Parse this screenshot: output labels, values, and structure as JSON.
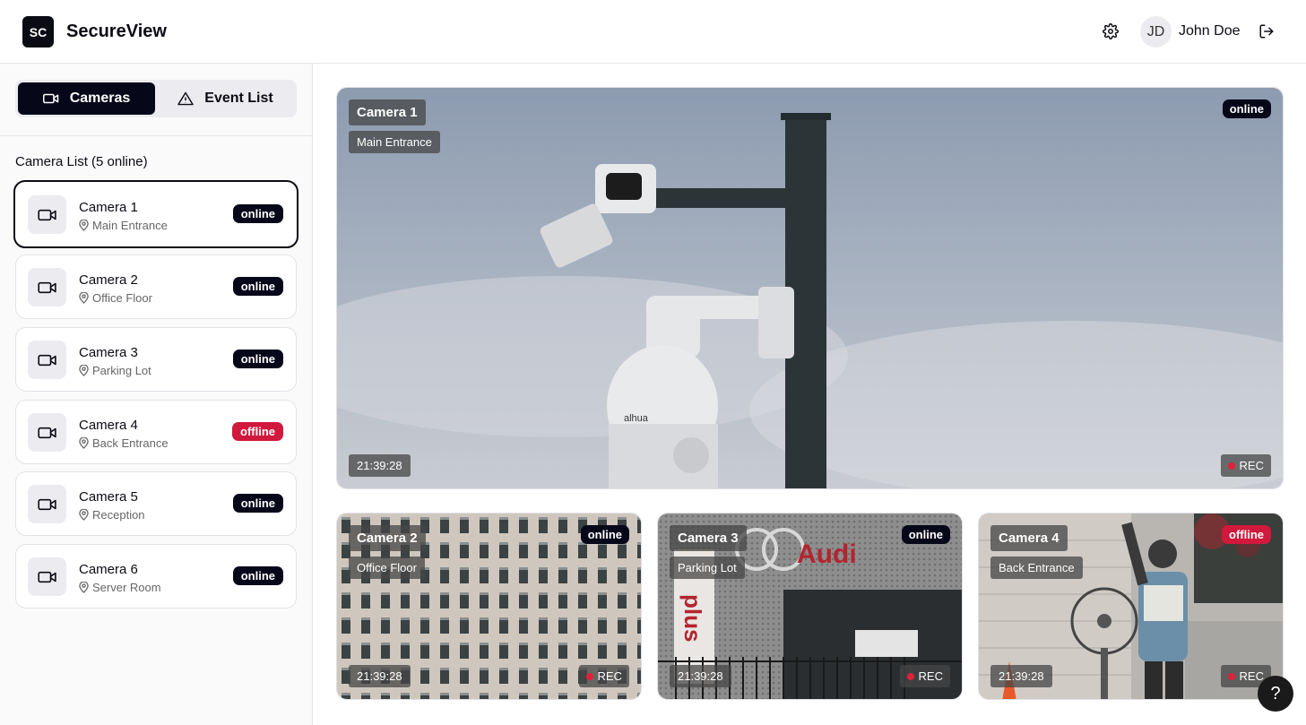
{
  "header": {
    "logo_text": "SC",
    "app_title": "SecureView",
    "user": {
      "initials": "JD",
      "name": "John Doe"
    }
  },
  "sidebar": {
    "tabs": [
      {
        "label": "Cameras",
        "icon": "video-icon",
        "active": true
      },
      {
        "label": "Event List",
        "icon": "warning-icon",
        "active": false
      }
    ],
    "list_title": "Camera List (5 online)",
    "cameras": [
      {
        "name": "Camera 1",
        "location": "Main Entrance",
        "status": "online"
      },
      {
        "name": "Camera 2",
        "location": "Office Floor",
        "status": "online"
      },
      {
        "name": "Camera 3",
        "location": "Parking Lot",
        "status": "online"
      },
      {
        "name": "Camera 4",
        "location": "Back Entrance",
        "status": "offline"
      },
      {
        "name": "Camera 5",
        "location": "Reception",
        "status": "online"
      },
      {
        "name": "Camera 6",
        "location": "Server Room",
        "status": "online"
      }
    ]
  },
  "main_feed": {
    "name": "Camera 1",
    "location": "Main Entrance",
    "status": "online",
    "time": "21:39:28",
    "rec": "REC"
  },
  "thumb_feeds": [
    {
      "name": "Camera 2",
      "location": "Office Floor",
      "status": "online",
      "time": "21:39:28",
      "rec": "REC"
    },
    {
      "name": "Camera 3",
      "location": "Parking Lot",
      "status": "online",
      "time": "21:39:28",
      "rec": "REC"
    },
    {
      "name": "Camera 4",
      "location": "Back Entrance",
      "status": "offline",
      "time": "21:39:28",
      "rec": "REC"
    }
  ],
  "help_label": "?",
  "colors": {
    "primary": "#07071a",
    "offline": "#d0193c",
    "rec": "#e0213b"
  }
}
